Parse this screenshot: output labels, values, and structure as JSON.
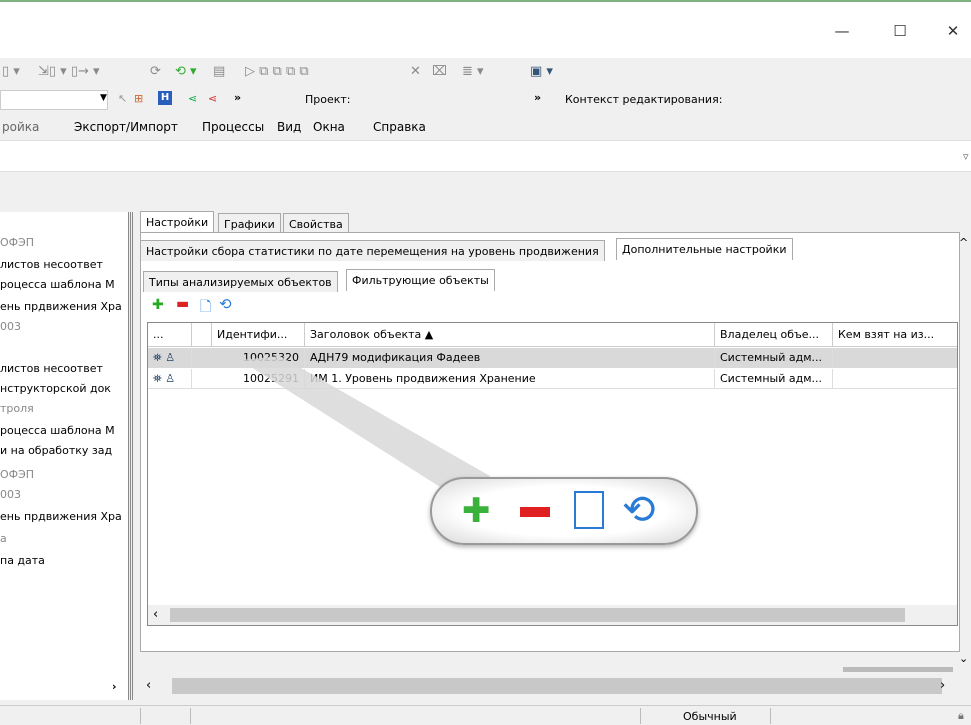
{
  "window": {
    "minimize": "—",
    "maximize": "☐",
    "close": "✕"
  },
  "toolbar2": {
    "project_label": "Проект:",
    "context_label": "Контекст редактирования:",
    "more1": "»",
    "more2": "»"
  },
  "menu": [
    "ройка",
    "Экспорт/Импорт",
    "Процессы",
    "Вид",
    "Окна",
    "Справка"
  ],
  "left_items": [
    "ОФЭП",
    "листов несоответ",
    "роцесса шаблона М",
    "ень прдвижения Хра",
    "003",
    "листов несоответ",
    "нструкторской док",
    "троля",
    "роцесса шаблона М",
    "и на обработку зад",
    "ОФЭП",
    "003",
    "ень прдвижения Хра",
    "а",
    "па дата"
  ],
  "tabs_top": [
    "Настройки",
    "Графики",
    "Свойства"
  ],
  "tabs_second": [
    "Настройки сбора статистики по дате перемещения на уровень продвижения",
    "Дополнительные настройки"
  ],
  "tabs_third": [
    "Типы анализируемых объектов",
    "Фильтрующие объекты"
  ],
  "grid": {
    "headers": [
      "...",
      "Идентифи...",
      "Заголовок объекта ▲",
      "Владелец объе...",
      "Кем взят на из..."
    ],
    "rows": [
      {
        "id": "10025320",
        "title": "АДН79 модификация Фадеев",
        "owner": "Системный адм..."
      },
      {
        "id": "10025291",
        "title": "ИМ 1. Уровень продвижения Хранение",
        "owner": "Системный адм..."
      }
    ]
  },
  "status": {
    "mode": "Обычный"
  },
  "scroll": {
    "left": "‹",
    "right": "›",
    "left2": "‹",
    "right2": "›",
    "down": "⌄",
    "up": "^"
  }
}
